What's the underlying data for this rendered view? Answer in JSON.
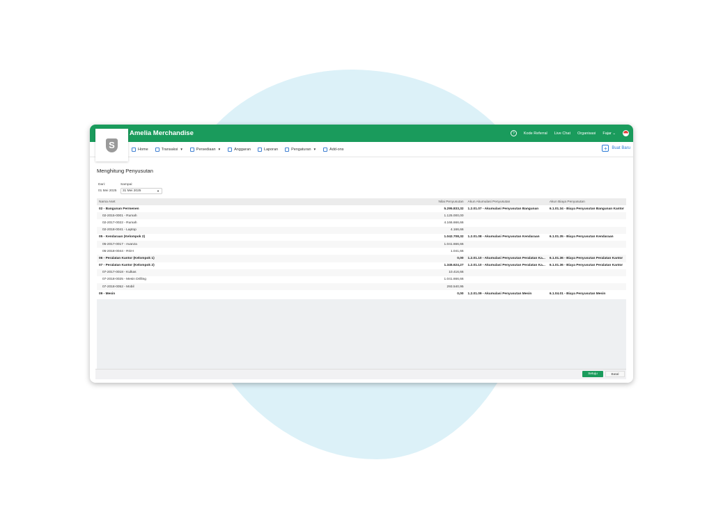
{
  "app": {
    "title": "Amelia Merchandise",
    "logo_letter": "S"
  },
  "topbar": {
    "help_icon": "?",
    "links": [
      "Kode Referral",
      "Live Chat",
      "Organisasi"
    ],
    "user": "Fajar",
    "user_caret": "⌄"
  },
  "menu": [
    {
      "label": "Home",
      "icon": "home-icon"
    },
    {
      "label": "Transaksi",
      "icon": "transaksi-icon",
      "caret": "▼"
    },
    {
      "label": "Persediaan",
      "icon": "persediaan-icon",
      "caret": "▼"
    },
    {
      "label": "Anggaran",
      "icon": "anggaran-icon"
    },
    {
      "label": "Laporan",
      "icon": "laporan-icon"
    },
    {
      "label": "Pengaturan",
      "icon": "pengaturan-icon",
      "caret": "▼"
    },
    {
      "label": "Add-ons",
      "icon": "addons-icon"
    }
  ],
  "new_button": {
    "label": "Buat Baru",
    "icon": "+"
  },
  "page": {
    "title": "Menghitung Penyusutan",
    "from_label": "Dari:",
    "from_value": "01 Mei 2025",
    "to_label": "Sampai:",
    "to_value": "31 Mei 2025",
    "to_caret": "▼"
  },
  "table": {
    "headers": [
      "Nama Aset",
      "Nilai Penyusutan",
      "Akun Akumulasi Penyusutan",
      "Akun Biaya Penyusutan"
    ],
    "rows": [
      {
        "name": "02 - Bangunan Permenen",
        "value": "5.295.833,32",
        "acc": "1.2.01.07 - Akumulasi Penyusutan Bangunan",
        "exp": "6.1.01.34 - Biaya Penyusutan Bangunan Kantor",
        "bold": true
      },
      {
        "name": "02-2015-0001 - Rumah",
        "value": "1.125.000,00",
        "acc": "",
        "exp": "",
        "bold": false
      },
      {
        "name": "02-2017-0022 - Rumah",
        "value": "4.166.666,66",
        "acc": "",
        "exp": "",
        "bold": false
      },
      {
        "name": "02-2018-0041 - Laptop",
        "value": "4.166,66",
        "acc": "",
        "exp": "",
        "bold": false
      },
      {
        "name": "05 - Kendaraan (Kelompok 2)",
        "value": "1.042.708,32",
        "acc": "1.2.01.08 - Akumulasi Penyusutan Kendaraan",
        "exp": "6.1.01.35 - Biaya Penyusutan Kendaraan",
        "bold": true
      },
      {
        "name": "05-2017-0017 - Avanza",
        "value": "1.041.666,66",
        "acc": "",
        "exp": "",
        "bold": false
      },
      {
        "name": "05-2018-0044 - RGH",
        "value": "1.041,66",
        "acc": "",
        "exp": "",
        "bold": false
      },
      {
        "name": "06 - Peralatan Kantor (Kelompok 1)",
        "value": "0,00",
        "acc": "1.2.01.10 - Akumulasi Penyusutan Peralatan Ka...",
        "exp": "6.1.01.36 - Biaya Penyusutan Peralatan Kantor",
        "bold": true
      },
      {
        "name": "07 - Peralatan Kantor (Kelompok 2)",
        "value": "1.345.624,27",
        "acc": "1.2.01.10 - Akumulasi Penyusutan Peralatan Ka...",
        "exp": "6.1.01.36 - Biaya Penyusutan Peralatan Kantor",
        "bold": true
      },
      {
        "name": "07-2017-0018 - Kulkas",
        "value": "10.416,66",
        "acc": "",
        "exp": "",
        "bold": false
      },
      {
        "name": "07-2018-0025 - Mesin Drilling",
        "value": "1.041.666,66",
        "acc": "",
        "exp": "",
        "bold": false
      },
      {
        "name": "07-2018-0052 - Mobil",
        "value": "293.540,95",
        "acc": "",
        "exp": "",
        "bold": false
      },
      {
        "name": "09 - Mesin",
        "value": "0,00",
        "acc": "1.2.01.09 - Akumulasi Penyusutan Mesin",
        "exp": "6.1.04.01 - Biaya Penyusutan Mesin",
        "bold": true
      }
    ]
  },
  "footer": {
    "ok": "Setuju",
    "cancel": "Batal"
  },
  "colors": {
    "brand": "#1a9b5c",
    "link": "#2b7bd6",
    "blob": "#dcf1f8"
  }
}
